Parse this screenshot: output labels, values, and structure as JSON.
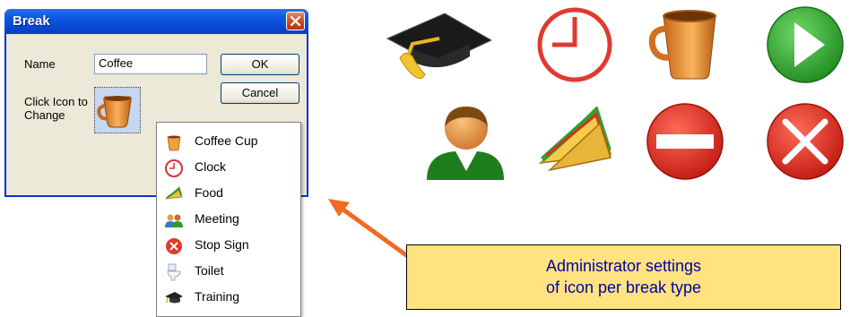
{
  "dialog": {
    "title": "Break",
    "name_label": "Name",
    "name_value": "Coffee",
    "icon_label_line1": "Click Icon to",
    "icon_label_line2": "Change",
    "ok_label": "OK",
    "cancel_label": "Cancel"
  },
  "menu": {
    "items": [
      {
        "label": "Coffee Cup",
        "icon": "coffee-cup-icon"
      },
      {
        "label": "Clock",
        "icon": "clock-icon"
      },
      {
        "label": "Food",
        "icon": "sandwich-icon"
      },
      {
        "label": "Meeting",
        "icon": "people-icon"
      },
      {
        "label": "Stop Sign",
        "icon": "stop-sign-icon"
      },
      {
        "label": "Toilet",
        "icon": "toilet-icon"
      },
      {
        "label": "Training",
        "icon": "graduation-cap-icon"
      }
    ]
  },
  "callout": {
    "line1": "Administrator settings",
    "line2": "of icon per break type"
  },
  "colors": {
    "titlebar": "#0a5ae0",
    "callout_bg": "#ffe380",
    "callout_text": "#0000a8",
    "arrow": "#f26a21"
  }
}
